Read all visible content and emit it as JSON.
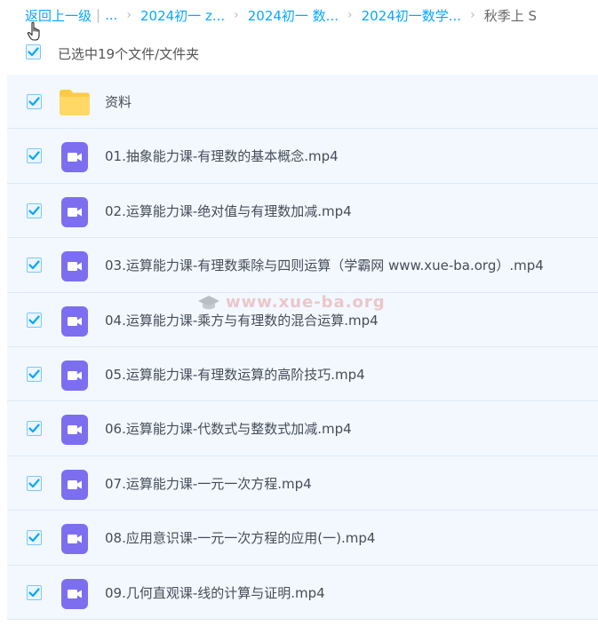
{
  "breadcrumb": {
    "back": "返回上一级",
    "separator": "|",
    "ellipsis": "...",
    "items": [
      "2024初一 z...",
      "2024初一 数...",
      "2024初一数学..."
    ],
    "current": "秋季上 S",
    "arrow": "›"
  },
  "selection": {
    "label": "已选中19个文件/文件夹",
    "checked": true
  },
  "files": [
    {
      "name": "资料",
      "type": "folder",
      "icon": "folder-icon",
      "checked": true
    },
    {
      "name": "01.抽象能力课-有理数的基本概念.mp4",
      "type": "video",
      "icon": "video-file-icon",
      "checked": true
    },
    {
      "name": "02.运算能力课-绝对值与有理数加减.mp4",
      "type": "video",
      "icon": "video-file-icon",
      "checked": true
    },
    {
      "name": "03.运算能力课-有理数乘除与四则运算（学霸网 www.xue-ba.org）.mp4",
      "type": "video",
      "icon": "video-file-icon",
      "checked": true
    },
    {
      "name": "04.运算能力课-乘方与有理数的混合运算.mp4",
      "type": "video",
      "icon": "video-file-icon",
      "checked": true
    },
    {
      "name": "05.运算能力课-有理数运算的高阶技巧.mp4",
      "type": "video",
      "icon": "video-file-icon",
      "checked": true
    },
    {
      "name": "06.运算能力课-代数式与整数式加减.mp4",
      "type": "video",
      "icon": "video-file-icon",
      "checked": true
    },
    {
      "name": "07.运算能力课-一元一次方程.mp4",
      "type": "video",
      "icon": "video-file-icon",
      "checked": true
    },
    {
      "name": "08.应用意识课-一元一次方程的应用(一).mp4",
      "type": "video",
      "icon": "video-file-icon",
      "checked": true
    },
    {
      "name": "09.几何直观课-线的计算与证明.mp4",
      "type": "video",
      "icon": "video-file-icon",
      "checked": true
    }
  ],
  "watermark": "www.xue-ba.org",
  "colors": {
    "link": "#06a7ff",
    "row_bg": "#f2f8fe",
    "check": "#06a7ff",
    "video_icon": "#7b6ff0",
    "folder": "#ffcb45"
  }
}
